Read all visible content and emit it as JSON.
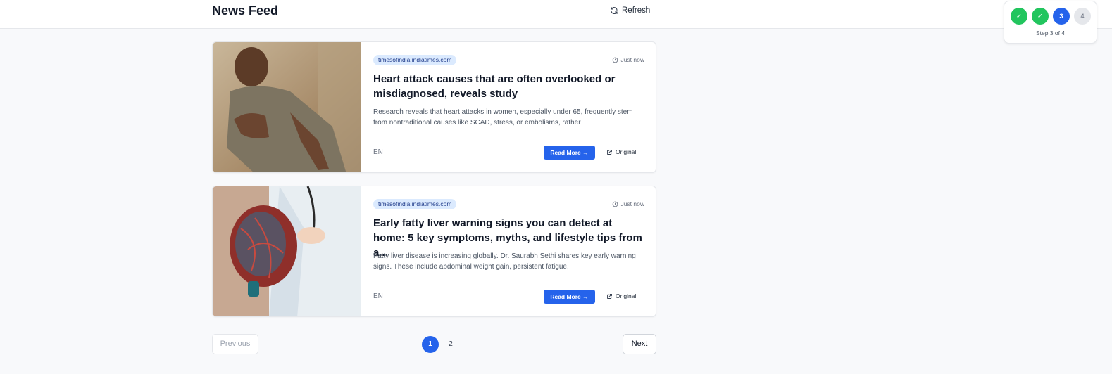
{
  "header": {
    "title": "News Feed",
    "refresh_label": "Refresh"
  },
  "stepper": {
    "steps": [
      {
        "label": "✓",
        "state": "done"
      },
      {
        "label": "✓",
        "state": "done"
      },
      {
        "label": "3",
        "state": "current"
      },
      {
        "label": "4",
        "state": "todo"
      }
    ],
    "status_text": "Step 3 of 4"
  },
  "articles": [
    {
      "source": "timesofindia.indiatimes.com",
      "time": "Just now",
      "headline": "Heart attack causes that are often overlooked or misdiagnosed, reveals study",
      "summary": "Research reveals that heart attacks in women, especially under 65, frequently stem from nontraditional causes like SCAD, stress, or embolisms, rather",
      "language": "EN",
      "read_more_label": "Read More →",
      "original_label": "Original",
      "image_icon": "man-clutching-chest-photo"
    },
    {
      "source": "timesofindia.indiatimes.com",
      "time": "Just now",
      "headline": "Early fatty liver warning signs you can detect at home: 5 key symptoms, myths, and lifestyle tips from a...",
      "summary": "Fatty liver disease is increasing globally. Dr. Saurabh Sethi shares key early warning signs. These include abdominal weight gain, persistent fatigue,",
      "language": "EN",
      "read_more_label": "Read More →",
      "original_label": "Original",
      "image_icon": "doctor-holding-liver-model-photo"
    }
  ],
  "pagination": {
    "previous_label": "Previous",
    "next_label": "Next",
    "pages": [
      "1",
      "2"
    ],
    "current_page": "1"
  },
  "colors": {
    "accent": "#2563eb",
    "done": "#22c55e",
    "badge_bg": "#dbeafe"
  }
}
